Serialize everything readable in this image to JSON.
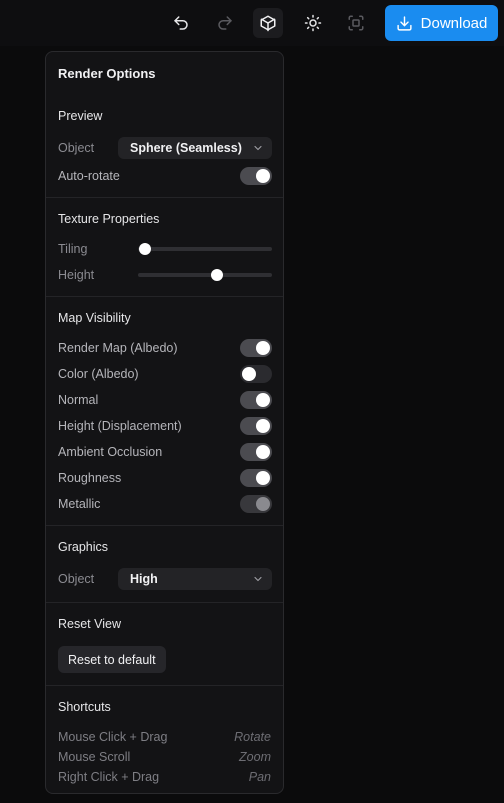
{
  "toolbar": {
    "icons": [
      "undo-icon",
      "redo-icon",
      "cube-icon",
      "sun-icon",
      "focus-icon",
      "download-icon"
    ],
    "download_label": "Download",
    "accent_color": "#1a8cf0"
  },
  "panel": {
    "title": "Render Options",
    "preview": {
      "title": "Preview",
      "object_label": "Object",
      "object_value": "Sphere (Seamless)",
      "autorotate_label": "Auto-rotate",
      "autorotate_on": true
    },
    "texture": {
      "title": "Texture Properties",
      "tiling_label": "Tiling",
      "tiling_value": 0.05,
      "height_label": "Height",
      "height_value": 0.59
    },
    "maps": {
      "title": "Map Visibility",
      "items": [
        {
          "label": "Render Map (Albedo)",
          "state": "on"
        },
        {
          "label": "Color (Albedo)",
          "state": "off"
        },
        {
          "label": "Normal",
          "state": "on"
        },
        {
          "label": "Height (Displacement)",
          "state": "on"
        },
        {
          "label": "Ambient Occlusion",
          "state": "on"
        },
        {
          "label": "Roughness",
          "state": "on"
        },
        {
          "label": "Metallic",
          "state": "disabled"
        }
      ]
    },
    "graphics": {
      "title": "Graphics",
      "object_label": "Object",
      "object_value": "High"
    },
    "reset": {
      "title": "Reset View",
      "button_label": "Reset to default"
    },
    "shortcuts": {
      "title": "Shortcuts",
      "items": [
        {
          "action": "Mouse Click + Drag",
          "result": "Rotate"
        },
        {
          "action": "Mouse Scroll",
          "result": "Zoom"
        },
        {
          "action": "Right Click + Drag",
          "result": "Pan"
        }
      ]
    }
  }
}
